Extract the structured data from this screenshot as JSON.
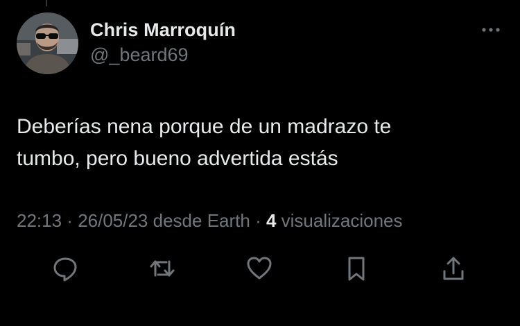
{
  "tweet": {
    "author": {
      "display_name": "Chris Marroquín",
      "handle": "@_beard69",
      "avatar_icon": "profile-photo"
    },
    "text": "Deberías nena porque de un madrazo te\ntumbo, pero bueno advertida estás",
    "meta": {
      "time": "22:13",
      "separator": " · ",
      "date": "26/05/23",
      "source": " desde Earth",
      "views_count": "4",
      "views_label": " visualizaciones"
    },
    "actions": [
      {
        "name": "reply",
        "icon": "reply-icon"
      },
      {
        "name": "retweet",
        "icon": "retweet-icon"
      },
      {
        "name": "like",
        "icon": "heart-icon"
      },
      {
        "name": "bookmark",
        "icon": "bookmark-icon"
      },
      {
        "name": "share",
        "icon": "share-icon"
      }
    ],
    "more_icon": "more-dots-icon"
  },
  "colors": {
    "background": "#000000",
    "primary_text": "#e7e9ea",
    "secondary_text": "#71767b",
    "icon": "#71767b"
  }
}
